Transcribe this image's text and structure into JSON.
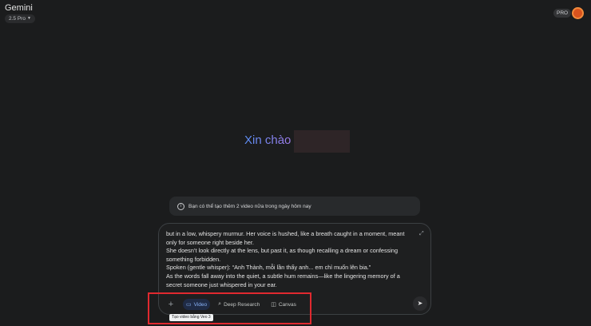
{
  "header": {
    "app_title": "Gemini",
    "model_label": "2.5 Pro",
    "pro_badge": "PRO"
  },
  "main": {
    "greeting": "Xin chào"
  },
  "notice": {
    "text": "Bạn có thể tạo thêm 2 video nữa trong ngày hôm nay",
    "icon": "info-icon"
  },
  "composer": {
    "prompt_lines": [
      "but in a low, whispery murmur. Her voice is hushed, like a breath caught in a moment, meant",
      "only for someone right beside her.",
      "She doesn’t look directly at the lens, but past it, as though recalling a dream or confessing",
      "something forbidden.",
      "Spoken (gentle whisper): “Anh Thành, mỗi lần thấy anh... em chỉ muốn lên bia.”",
      "As the words fall away into the quiet, a subtle hum remains—like the lingering memory of a",
      "secret someone just whispered in your ear."
    ],
    "tools": {
      "video": "Video",
      "deep_research": "Deep Research",
      "canvas": "Canvas"
    },
    "tooltip": "Tạo video bằng Veo 3"
  },
  "colors": {
    "accent": "#8ab4f8",
    "highlight": "#e0292f",
    "avatar": "#d9531e"
  }
}
